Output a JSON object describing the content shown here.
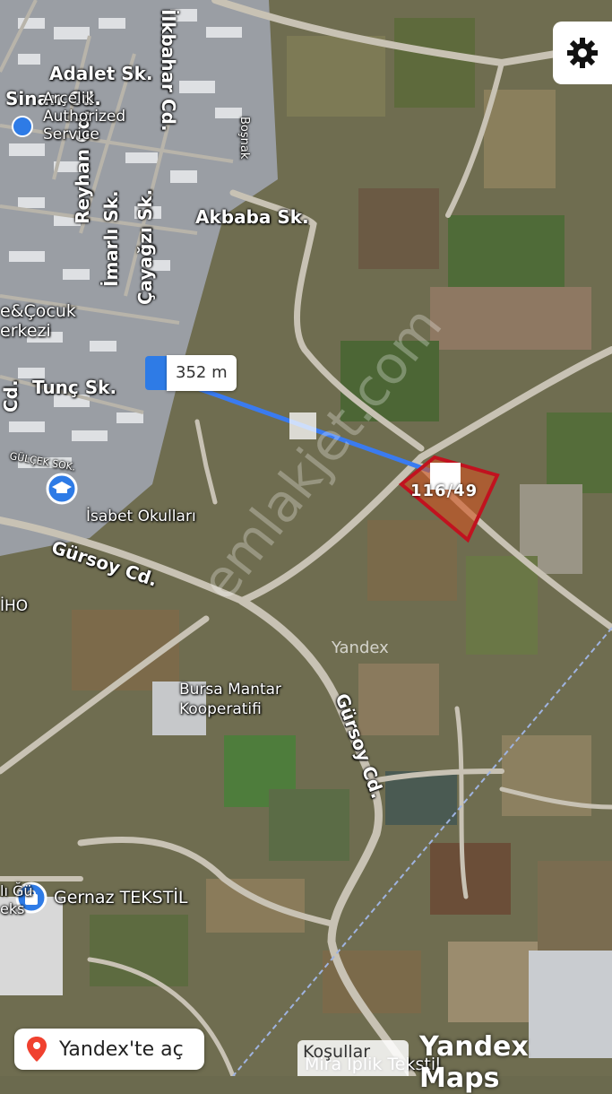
{
  "map": {
    "street_labels": [
      {
        "id": "adalet",
        "text": "Adalet Sk."
      },
      {
        "id": "sinan",
        "text": "Sinan Cd."
      },
      {
        "id": "ilkbahar",
        "text": "İlkbahar Cd."
      },
      {
        "id": "reyhan",
        "text": "Reyhan Cd."
      },
      {
        "id": "akbaba",
        "text": "Akbaba Sk."
      },
      {
        "id": "imarli",
        "text": "İmarlı Sk."
      },
      {
        "id": "cayagzi",
        "text": "Çayağzı Sk."
      },
      {
        "id": "tunc",
        "text": "Tunç Sk."
      },
      {
        "id": "gursoy1",
        "text": "Gürsoy Cd."
      },
      {
        "id": "gursoy2",
        "text": "Gürsoy Cd."
      },
      {
        "id": "bosnak",
        "text": "Boşnak"
      },
      {
        "id": "cd-left",
        "text": "Cd."
      }
    ],
    "poi_labels": [
      {
        "id": "arcelik",
        "text": "Arçelik Authorized Service"
      },
      {
        "id": "cocuk",
        "text": "e&Çocuk\nerkezi"
      },
      {
        "id": "isabet",
        "text": "İsabet Okulları"
      },
      {
        "id": "iho",
        "text": "İHO"
      },
      {
        "id": "mantar",
        "text": "Bursa Mantar\nKooperatifi"
      },
      {
        "id": "gernaz",
        "text": "Gernaz TEKSTİL"
      },
      {
        "id": "mira",
        "text": "Mira Iplik Tekstil"
      },
      {
        "id": "left-clip",
        "text": "lı Ğü\neks"
      },
      {
        "id": "gulcek",
        "text": "GÜLÇEK SOK."
      }
    ],
    "distance": "352 m",
    "parcel": "116/49",
    "yandex_watermark": "Yandex",
    "site_watermark": "emlakjet.com",
    "colors": {
      "route": "#3a7bf0",
      "parcel_outline": "#c1121f",
      "parcel_fill": "#d2541f",
      "accent": "#2e7be6"
    }
  },
  "controls": {
    "settings_icon": "gear-icon",
    "open_button_label": "Yandex'te aç",
    "open_button_icon": "location-pin-icon",
    "terms_label": "Koşullar",
    "brand": "Yandex Maps"
  }
}
